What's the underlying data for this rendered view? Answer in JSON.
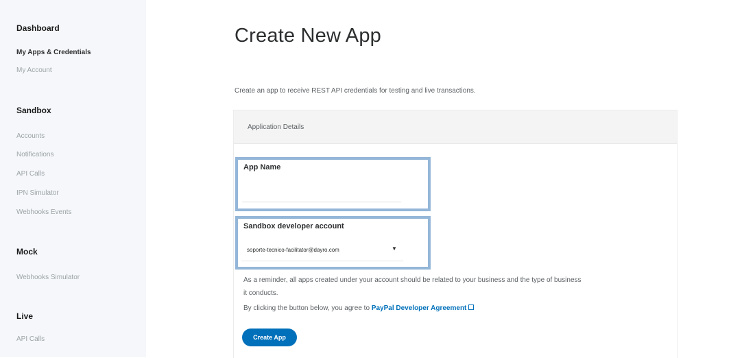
{
  "sidebar": {
    "dashboard": "Dashboard",
    "my_apps": "My Apps & Credentials",
    "my_account": "My Account",
    "sandbox_heading": "Sandbox",
    "sandbox_items": [
      "Accounts",
      "Notifications",
      "API Calls",
      "IPN Simulator",
      "Webhooks Events"
    ],
    "mock_heading": "Mock",
    "mock_items": [
      "Webhooks Simulator"
    ],
    "live_heading": "Live",
    "live_items": [
      "API Calls"
    ]
  },
  "main": {
    "title": "Create New App",
    "intro": "Create an app to receive REST API credentials for testing and live transactions.",
    "panel_header": "Application Details",
    "app_name_label": "App Name",
    "app_name_value": "",
    "sandbox_account_label": "Sandbox developer account",
    "sandbox_account_value": "soporte-tecnico-facilitator@dayro.com",
    "reminder_line1": "As a reminder, all apps created under your account should be related to your business and the type of business",
    "reminder_line2": "it conducts.",
    "agree_prefix": "By clicking the button below, you agree to ",
    "agree_link": "PayPal Developer Agreement",
    "create_button": "Create App"
  },
  "colors": {
    "highlight_border": "#94b6d8",
    "link": "#0070ba",
    "button": "#0070ba"
  }
}
